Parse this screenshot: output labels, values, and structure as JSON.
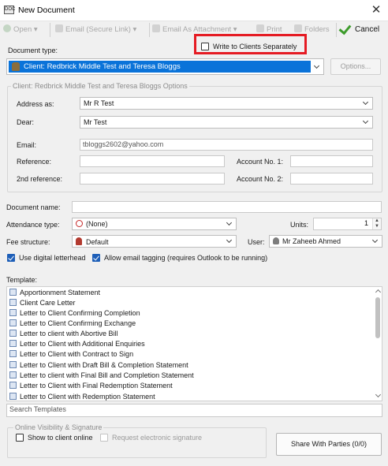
{
  "window": {
    "title": "New Document",
    "icon_text": "DOC"
  },
  "toolbar": {
    "open": "Open",
    "email_secure": "Email (Secure Link)",
    "email_attachment": "Email As Attachment",
    "print": "Print",
    "folders": "Folders",
    "cancel": "Cancel"
  },
  "write_separately": {
    "label": "Write to Clients Separately",
    "checked": false
  },
  "doc_type": {
    "label": "Document type:",
    "value": "Client: Redbrick Middle Test and Teresa Bloggs",
    "options_button": "Options..."
  },
  "client_group": {
    "title": "Client: Redbrick Middle Test and Teresa Bloggs Options",
    "address_as_label": "Address as:",
    "address_as_value": "Mr R Test",
    "dear_label": "Dear:",
    "dear_value": "Mr Test",
    "email_label": "Email:",
    "email_value": "tbloggs2602@yahoo.com",
    "reference_label": "Reference:",
    "reference_value": "",
    "account1_label": "Account No. 1:",
    "account1_value": "",
    "ref2_label": "2nd reference:",
    "ref2_value": "",
    "account2_label": "Account No. 2:",
    "account2_value": ""
  },
  "document_name": {
    "label": "Document name:",
    "value": ""
  },
  "attendance": {
    "label": "Attendance type:",
    "value": "(None)"
  },
  "units": {
    "label": "Units:",
    "value": "1"
  },
  "fee": {
    "label": "Fee structure:",
    "value": "Default"
  },
  "user": {
    "label": "User:",
    "value": "Mr Zaheeb Ahmed"
  },
  "digital_letterhead": {
    "label": "Use digital letterhead",
    "checked": true
  },
  "email_tagging": {
    "label": "Allow email tagging (requires Outlook to be running)",
    "checked": true
  },
  "template": {
    "label": "Template:",
    "items": [
      "Apportionment Statement",
      "Client Care Letter",
      "Letter to Client Confirming Completion",
      "Letter to Client Confirming Exchange",
      "Letter to client with Abortive Bill",
      "Letter to Client with Additional Enquiries",
      "Letter to Client with Contract to Sign",
      "Letter to Client with Draft Bill & Completion Statement",
      "Letter to client with Final Bill and Completion Statement",
      "Letter to Client with Final Redemption Statement",
      "Letter to Client with Redemption Statement"
    ]
  },
  "search_templates": {
    "placeholder": "Search Templates"
  },
  "online_group": {
    "title": "Online Visibility & Signature",
    "show_to_client": "Show to client online",
    "request_signature": "Request electronic signature"
  },
  "share_button": "Share With Parties (0/0)",
  "colors": {
    "selection_blue": "#0a73d9",
    "highlight_red": "#e51b23",
    "check_blue": "#1e5fb8"
  }
}
